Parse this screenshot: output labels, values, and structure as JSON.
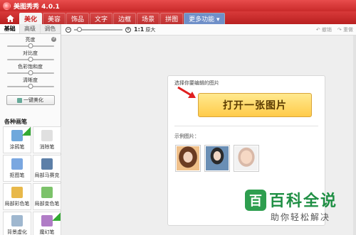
{
  "app": {
    "title": "美图秀秀 4.0.1"
  },
  "menu": {
    "items": [
      "美化",
      "美容",
      "饰品",
      "文字",
      "边框",
      "场景",
      "拼图"
    ],
    "more_label": "更多功能 ▾"
  },
  "left_panel": {
    "tabs": [
      "基础",
      "高级",
      "调色"
    ],
    "sliders": [
      {
        "label": "亮度",
        "value": 0.5
      },
      {
        "label": "对比度",
        "value": 0.5
      },
      {
        "label": "色彩饱和度",
        "value": 0.5
      },
      {
        "label": "清晰度",
        "value": 0.5
      }
    ],
    "one_click_label": "一键美化",
    "section_title": "各种画笔",
    "tools": [
      {
        "label": "涂鸦笔",
        "icon": "graffiti-pen-icon",
        "color": "#6fa8dc",
        "badge": true
      },
      {
        "label": "消除笔",
        "icon": "eraser-pen-icon",
        "color": "#e0e0e0",
        "badge": false
      },
      {
        "label": "抠图笔",
        "icon": "cutout-pen-icon",
        "color": "#7aa7e0",
        "badge": false
      },
      {
        "label": "局部马赛克",
        "icon": "mosaic-icon",
        "color": "#5d7fa8",
        "badge": false
      },
      {
        "label": "局部彩色笔",
        "icon": "color-brush-icon",
        "color": "#e8b84a",
        "badge": false
      },
      {
        "label": "局部变色笔",
        "icon": "color-change-icon",
        "color": "#7cc26a",
        "badge": false
      },
      {
        "label": "背景虚化",
        "icon": "blur-icon",
        "color": "#9fb7cf",
        "badge": false
      },
      {
        "label": "魔幻笔",
        "icon": "magic-pen-icon",
        "color": "#b07cc6",
        "badge": true
      }
    ]
  },
  "toolbar": {
    "zoom_fraction": 0.06,
    "actual_size_ratio": "1:1",
    "actual_size_label": "原大",
    "undo_label": "撤销",
    "redo_label": "重做"
  },
  "canvas": {
    "hint": "选择你要编辑的图片",
    "open_button": "打开一张图片",
    "sample_label": "示例图片："
  },
  "watermark": {
    "logo": "百",
    "title": "百科全说",
    "subtitle": "助你轻松解决"
  }
}
